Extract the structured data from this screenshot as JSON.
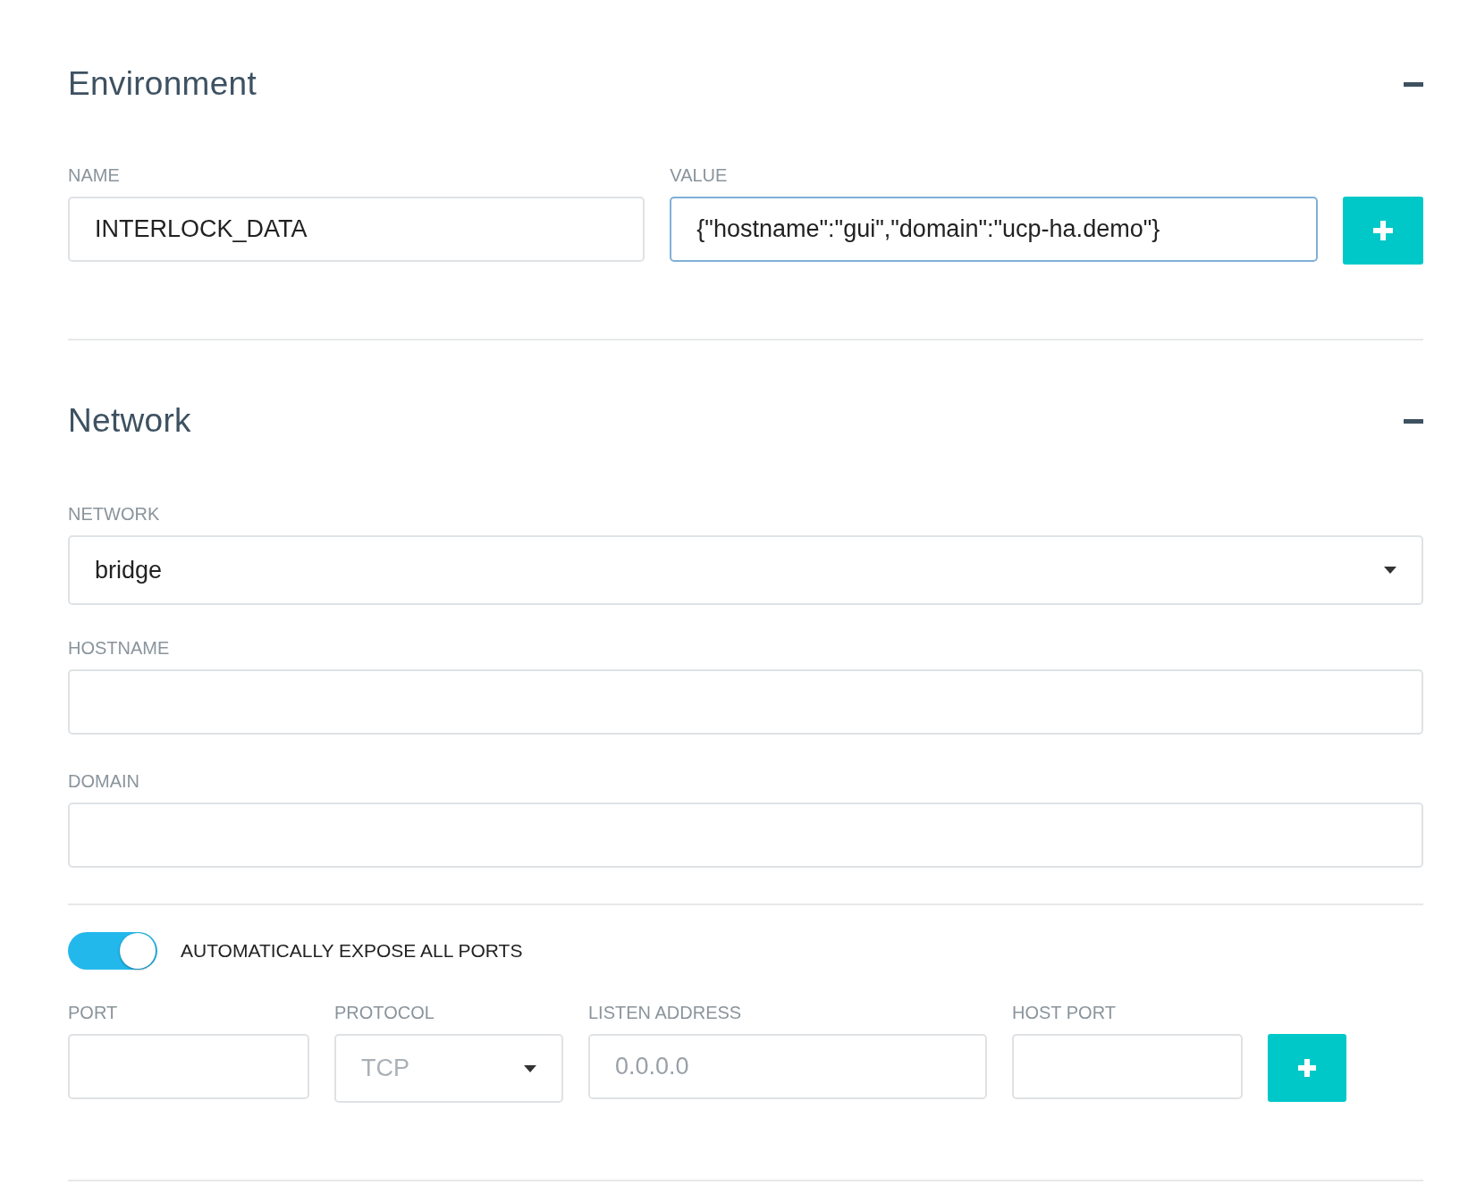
{
  "environment": {
    "title": "Environment",
    "name_field": {
      "label": "NAME",
      "value": "INTERLOCK_DATA",
      "focused": false
    },
    "value_field": {
      "label": "VALUE",
      "value": "{\"hostname\":\"gui\",\"domain\":\"ucp-ha.demo\"}",
      "focused": true
    }
  },
  "network": {
    "title": "Network",
    "network_select": {
      "label": "NETWORK",
      "value": "bridge"
    },
    "hostname": {
      "label": "HOSTNAME"
    },
    "domain": {
      "label": "DOMAIN"
    },
    "auto_expose": {
      "label": "AUTOMATICALLY EXPOSE ALL PORTS",
      "on": true
    },
    "ports": {
      "port": {
        "label": "PORT"
      },
      "protocol": {
        "label": "PROTOCOL",
        "value": "TCP",
        "disabled": true
      },
      "listen_address": {
        "label": "LISTEN ADDRESS",
        "placeholder": "0.0.0.0"
      },
      "host_port": {
        "label": "HOST PORT"
      }
    }
  }
}
